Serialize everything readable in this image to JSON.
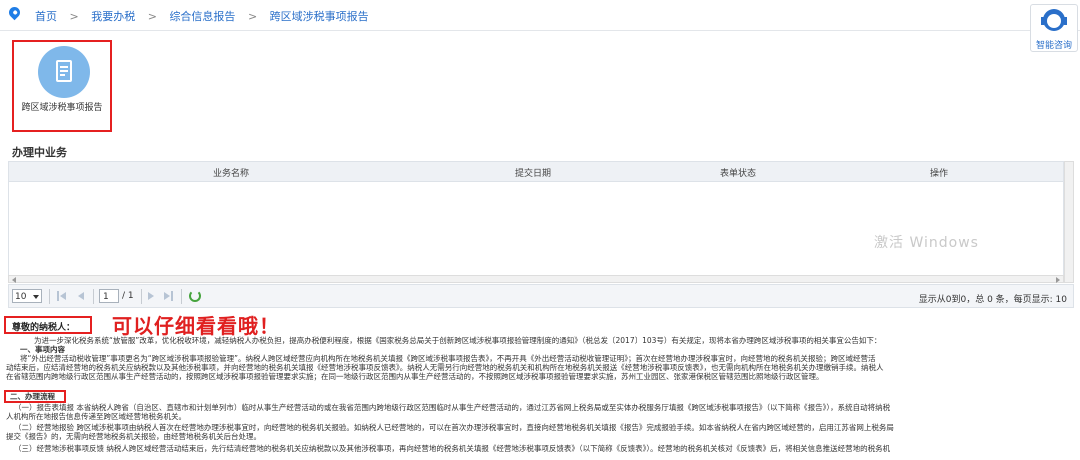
{
  "breadcrumb": {
    "items": [
      "首页",
      "我要办税",
      "综合信息报告",
      "跨区域涉税事项报告"
    ],
    "separator": ">"
  },
  "assistant": {
    "label": "智能咨询"
  },
  "quick_card": {
    "label": "跨区域涉税事项报告"
  },
  "section": {
    "title": "办理中业务"
  },
  "grid": {
    "columns": [
      "业务名称",
      "提交日期",
      "表单状态",
      "操作"
    ]
  },
  "pager": {
    "page_size": "10",
    "current_page": "1",
    "total_pages": "/ 1",
    "summary": "显示从0到0，总 0 条，每页显示: 10"
  },
  "watermark": {
    "text": "激活 Windows"
  },
  "notice": {
    "greeting": "尊敬的纳税人：",
    "callout": "可以仔细看看哦！",
    "lines": [
      "为进一步深化税务系统“放管服”改革，优化税收环境，减轻纳税人办税负担，提高办税便利程度，根据《国家税务总局关于创新跨区域涉税事项报验管理制度的通知》（税总发〔2017〕103号）有关规定，现将本省办理跨区域涉税事项的相关事宜公告如下：",
      "一、事项内容",
      "将“外出经营活动税收管理”事项更名为“跨区域涉税事项报验管理”。纳税人跨区域经营应向机构所在地税务机关填报《跨区域涉税事项报告表》，不再开具《外出经营活动税收管理证明》；首次在经营地办理涉税事宜时，向经营地的税务机关报验；跨区域经营活",
      "动结束后，应结清经营地的税务机关应纳税款以及其他涉税事项，并向经营地的税务机关填报《经营地涉税事项反馈表》。纳税人无需另行向经营地的税务机关和机构所在地税务机关报送《经营地涉税事项反馈表》，也无需向机构所在地税务机关办理缴销手续。纳税人",
      "在省辖范围内跨地级行政区范围从事生产经营活动的，按照跨区域涉税事项报验管理要求实施；在同一地级行政区范围内从事生产经营活动的，不按照跨区域涉税事项报验管理要求实施，苏州工业园区、张家港保税区管辖范围比照地级行政区管理。",
      "二、办理流程",
      "（一）报告表填报 本省纳税人跨省（自治区、直辖市和计划单列市）临时从事生产经营活动的或在我省范围内跨地级行政区范围临时从事生产经营活动的，通过江苏省网上税务局或至实体办税服务厅填报《跨区域涉税事项报告》（以下简称《报告》），系统自动将纳税",
      "人机构所在地报告信息传递至跨区域经营地税务机关。",
      "（二）经营地报验 跨区域涉税事项由纳税人首次在经营地办理涉税事宜时，向经营地的税务机关报验。如纳税人已经营地的，可以在首次办理涉税事宜时，直接向经营地税务机关填报《报告》完成报验手续。如本省纳税人在省内跨区域经营的，启用江苏省网上税务局",
      "提交《报告》的，无需向经营地税务机关报验，由经营地税务机关后台处理。",
      "（三）经营地涉税事项反馈 纳税人跨区域经营活动结束后，先行结清经营地的税务机关应纳税款以及其他涉税事项，再向经营地的税务机关填报《经营地涉税事项反馈表》（以下简称《反馈表》）。经营地的税务机关核对《反馈表》后，将相关信息推送经营地的税务机"
    ]
  },
  "colors": {
    "accent": "#2a6fc9",
    "highlight": "#e52020",
    "card_circle": "#7fb8ea",
    "header_bg": "#eef1f5"
  }
}
